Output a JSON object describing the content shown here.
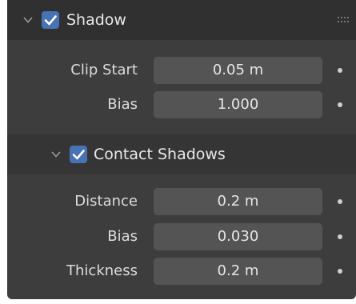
{
  "shadow_panel": {
    "title": "Shadow",
    "enabled": true,
    "properties": [
      {
        "label": "Clip Start",
        "value": "0.05 m"
      },
      {
        "label": "Bias",
        "value": "1.000"
      }
    ]
  },
  "contact_shadows": {
    "title": "Contact Shadows",
    "enabled": true,
    "properties": [
      {
        "label": "Distance",
        "value": "0.2 m"
      },
      {
        "label": "Bias",
        "value": "0.030"
      },
      {
        "label": "Thickness",
        "value": "0.2 m"
      }
    ]
  },
  "icons": {
    "collapse": "chevron-down-icon",
    "check": "checkmark-icon",
    "drag": "drag-handle-icon",
    "keyframe": "keyframe-dot-icon"
  },
  "colors": {
    "panel_bg": "#3d3d3d",
    "header_bg": "#303030",
    "field_bg": "#545454",
    "checkbox_accent": "#4772b3",
    "text": "#e8e8e8"
  }
}
